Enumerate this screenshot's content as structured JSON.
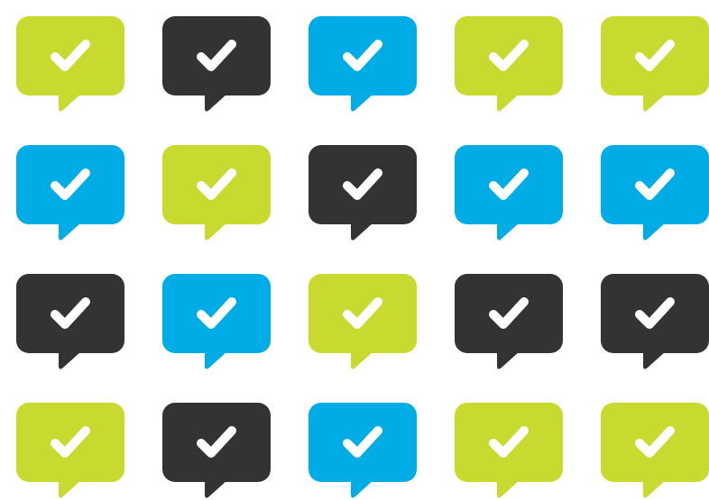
{
  "colors": {
    "lime": "#c8da2f",
    "dark": "#333333",
    "blue": "#00ace6",
    "check": "#ffffff",
    "background": "#ffffff"
  },
  "icon": {
    "name": "check-speech-bubble-icon",
    "glyph": "chat bubble with checkmark"
  },
  "grid": {
    "rows": [
      [
        "lime",
        "dark",
        "blue",
        "lime",
        "lime"
      ],
      [
        "blue",
        "lime",
        "dark",
        "blue",
        "blue"
      ],
      [
        "dark",
        "blue",
        "lime",
        "dark",
        "dark"
      ],
      [
        "lime",
        "dark",
        "blue",
        "lime",
        "lime"
      ]
    ]
  }
}
